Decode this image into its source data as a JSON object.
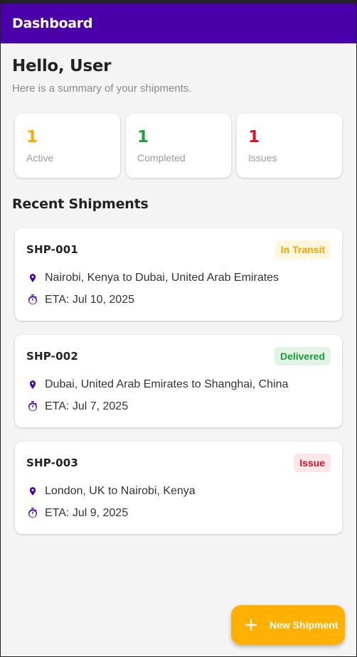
{
  "appbar": {
    "title": "Dashboard"
  },
  "greeting": {
    "title": "Hello, User",
    "subtitle": "Here is a summary of your shipments."
  },
  "stats": [
    {
      "value": "1",
      "label": "Active",
      "color": "#ffaa00"
    },
    {
      "value": "1",
      "label": "Completed",
      "color": "#1aa33a"
    },
    {
      "value": "1",
      "label": "Issues",
      "color": "#e0102a"
    }
  ],
  "section": {
    "title": "Recent Shipments"
  },
  "shipments": [
    {
      "id": "SHP-001",
      "status": "In Transit",
      "status_color": "#f5a300",
      "status_bg": "#fff6e0",
      "route": "Nairobi, Kenya to Dubai, United Arab Emirates",
      "eta": "ETA: Jul 10, 2025",
      "route_icon": "location-pin-icon",
      "eta_icon": "stopwatch-icon"
    },
    {
      "id": "SHP-002",
      "status": "Delivered",
      "status_color": "#1a9a3a",
      "status_bg": "#e3f4e6",
      "route": "Dubai, United Arab Emirates to Shanghai, China",
      "eta": "ETA: Jul 7, 2025",
      "route_icon": "location-pin-icon",
      "eta_icon": "stopwatch-icon"
    },
    {
      "id": "SHP-003",
      "status": "Issue",
      "status_color": "#d0102a",
      "status_bg": "#fde6e8",
      "route": "London, UK to Nairobi, Kenya",
      "eta": "ETA: Jul 9, 2025",
      "route_icon": "location-pin-icon",
      "eta_icon": "stopwatch-icon"
    }
  ],
  "fab": {
    "label": "New Shipment",
    "icon": "plus-icon"
  },
  "colors": {
    "primary": "#4a00a8",
    "accent": "#ffb000"
  }
}
